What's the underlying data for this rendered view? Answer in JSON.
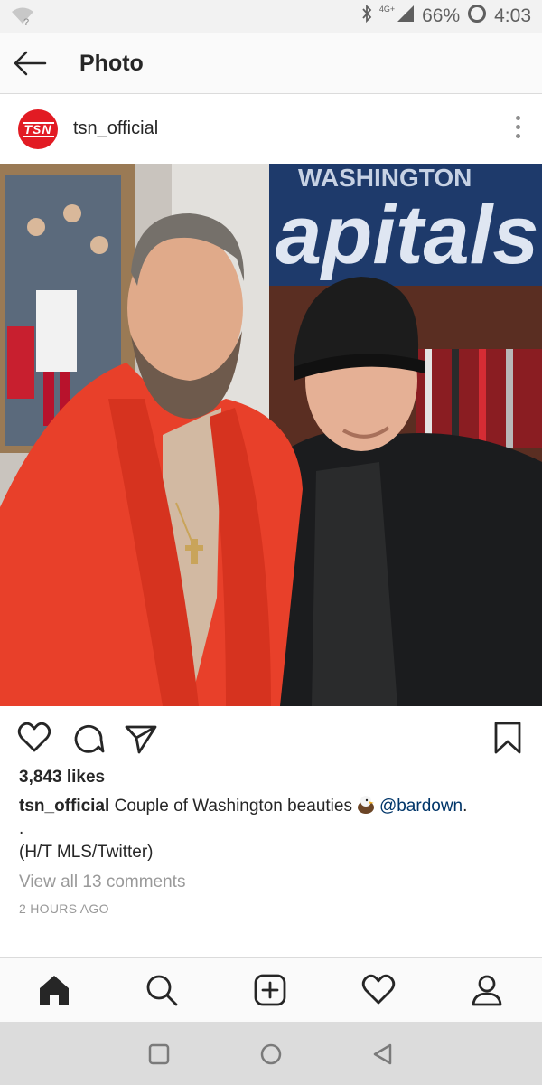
{
  "status_bar": {
    "wifi_icon": "wifi-unknown-icon",
    "network": "4G+",
    "battery_percent": "66%",
    "time": "4:03"
  },
  "header": {
    "back_icon": "back-arrow-icon",
    "title": "Photo"
  },
  "post": {
    "username": "tsn_official",
    "avatar_text": "TSN",
    "more_icon": "more-vertical-icon",
    "photo_description_icon": "photo",
    "likes": "3,843 likes",
    "caption_user": "tsn_official",
    "caption_text": "Couple of Washington beauties",
    "caption_emoji_icon": "eagle-emoji-icon",
    "mention": "@bardown",
    "mention_suffix": ".",
    "dot_line": ".",
    "ht_line": "(H/T MLS/Twitter)",
    "view_comments": "View all 13 comments",
    "timestamp": "2 HOURS AGO"
  },
  "actions": [
    "heart-icon",
    "comment-icon",
    "share-icon",
    "bookmark-icon"
  ],
  "tabs": [
    "home-icon",
    "search-icon",
    "new-post-icon",
    "activity-icon",
    "profile-icon"
  ],
  "system_nav": [
    "recents-icon",
    "home-circle-icon",
    "back-triangle-icon"
  ],
  "colors": {
    "link": "#003569",
    "brand_red": "#e21b23",
    "muted": "#999999"
  }
}
